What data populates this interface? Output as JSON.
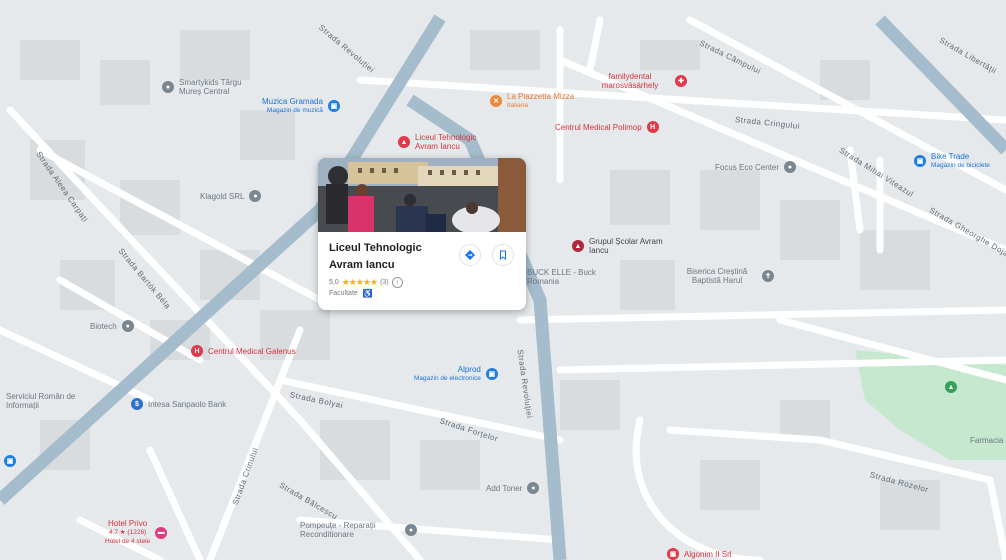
{
  "map": {
    "streets": [
      "Strada Revoluției",
      "Strada Câmpului",
      "Strada Cringului",
      "Strada Libertăţii",
      "Strada Aleea Carpați",
      "Strada Bartók Béla",
      "Strada Mihai Viteazul",
      "Strada Gheorghe Doja",
      "Strada Revoluţiei",
      "Strada Bolyai",
      "Strada Forțelor",
      "Strada Crinului",
      "Strada Rozelor",
      "Strada Bălcescu"
    ],
    "pois": [
      {
        "name": "Smartykids Târgu Mureș Central",
        "sub": "",
        "color": "grey",
        "icon": "pin-icon"
      },
      {
        "name": "Muzica Gramada",
        "sub": "Magazin de muzică",
        "color": "blue",
        "icon": "shop-icon"
      },
      {
        "name": "La Piazzetta Mizza",
        "sub": "Italiana",
        "color": "orange",
        "icon": "restaurant-icon"
      },
      {
        "name": "familydental marosvásárhely",
        "sub": "",
        "color": "red",
        "icon": "tooth-icon"
      },
      {
        "name": "Centrul Medical Polimop",
        "sub": "",
        "color": "red",
        "icon": "hospital-icon"
      },
      {
        "name": "Liceul Tehnologic Avram Iancu",
        "sub": "",
        "color": "red",
        "icon": "school-icon"
      },
      {
        "name": "Focus Eco Center",
        "sub": "",
        "color": "grey",
        "icon": "pin-icon"
      },
      {
        "name": "Bike Trade",
        "sub": "Magazin de biciclete",
        "color": "blue",
        "icon": "shop-icon"
      },
      {
        "name": "Klagold SRL",
        "sub": "",
        "color": "grey",
        "icon": "pin-icon"
      },
      {
        "name": "Grupul Școlar Avram Iancu",
        "sub": "",
        "color": "darkred",
        "icon": "school-icon"
      },
      {
        "name": "BUCK ELLE - Buck Romania",
        "sub": "",
        "color": "grey",
        "icon": "pin-icon"
      },
      {
        "name": "Biserica Creștină Baptistă Harul",
        "sub": "",
        "color": "grey",
        "icon": "church-icon"
      },
      {
        "name": "Biotech",
        "sub": "",
        "color": "grey",
        "icon": "pin-icon"
      },
      {
        "name": "Centrul Medical Galenus",
        "sub": "",
        "color": "red",
        "icon": "hospital-icon"
      },
      {
        "name": "Alprod",
        "sub": "Magazin de electronice",
        "color": "blue",
        "icon": "shop-icon"
      },
      {
        "name": "Serviciul Român de Informații",
        "sub": "",
        "color": "grey",
        "icon": "pin-icon"
      },
      {
        "name": "Intesa Sanpaolo Bank",
        "sub": "",
        "color": "grey",
        "icon": "bank-icon"
      },
      {
        "name": "Add Toner",
        "sub": "",
        "color": "grey",
        "icon": "pin-icon"
      },
      {
        "name": "Hotel Privo",
        "sub": "4.7 ★ (1226)",
        "color": "red",
        "icon": "bed-icon"
      },
      {
        "name": "Hotel de 4 stele",
        "sub": "",
        "color": "red",
        "icon": ""
      },
      {
        "name": "Pompeuțe - Reparații Reconditionare",
        "sub": "",
        "color": "grey",
        "icon": "pin-icon"
      },
      {
        "name": "Algonim II Srl",
        "sub": "",
        "color": "red",
        "icon": "shop-icon"
      },
      {
        "name": "Farmacia",
        "sub": "",
        "color": "grey",
        "icon": "pharmacy-icon"
      }
    ]
  },
  "card": {
    "name": "Liceul Tehnologic Avram Iancu",
    "rating_value": "5,0",
    "stars": "★★★★★",
    "review_count": "(3)",
    "category": "Facultate",
    "directions_label": "Direcții",
    "save_label": "Salvează"
  },
  "colors": {
    "major_road": "#9fb8c7",
    "minor_road": "#ffffff",
    "park": "#c5e8cf",
    "block": "#d6dadd"
  }
}
